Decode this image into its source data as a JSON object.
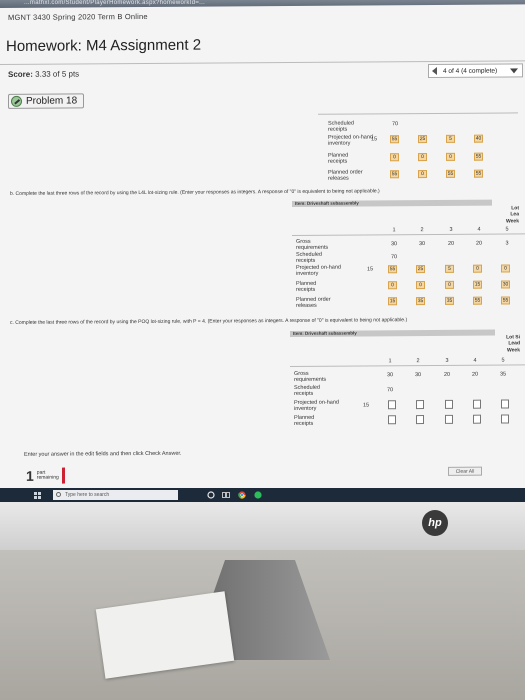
{
  "browser": {
    "url_fragment": "...mathxl.com/Student/PlayerHomework.aspx?homeworkId=..."
  },
  "header": {
    "course": "MGNT 3430 Spring 2020 Term B Online",
    "title": "Homework: M4 Assignment 2"
  },
  "score": {
    "label": "Score:",
    "value": "3.33 of 5 pts"
  },
  "question_nav": {
    "label": "4 of 4 (4 complete)"
  },
  "problem": {
    "label": "Problem 18"
  },
  "part_a": {
    "labels": [
      "Scheduled",
      "receipts",
      "Projected on-hand",
      "inventory",
      "Planned",
      "receipts",
      "Planned order",
      "releases"
    ],
    "scheduled": "70",
    "onhand_start": "15",
    "projected": [
      "55",
      "25",
      "5",
      "40"
    ],
    "planned_receipts": [
      "0",
      "0",
      "0",
      "55"
    ],
    "planned_releases": [
      "55",
      "0",
      "55",
      "55"
    ]
  },
  "part_b": {
    "instruction": "b. Complete the last three rows of the record by using the L4L lot-sizing rule. (Enter your responses as integers. A response of \"0\" is equivalent to being not applicable.)",
    "item": "Item: Driveshaft subassembly",
    "side": [
      "Lot",
      "Lea",
      "Week"
    ],
    "weeks": [
      "1",
      "2",
      "3",
      "4",
      "5"
    ],
    "gross": [
      "30",
      "30",
      "20",
      "20",
      "3"
    ],
    "scheduled": "70",
    "onhand_start": "15",
    "projected": [
      "55",
      "25",
      "5",
      "0",
      "0"
    ],
    "planned_receipts": [
      "0",
      "0",
      "0",
      "15",
      "30"
    ],
    "planned_releases": [
      "15",
      "35",
      "35",
      "55",
      "55"
    ],
    "labels": [
      "Gross",
      "requirements",
      "Scheduled",
      "receipts",
      "Projected on-hand",
      "inventory",
      "Planned",
      "receipts",
      "Planned order",
      "releases"
    ]
  },
  "part_c": {
    "instruction": "c. Complete the last three rows of the record by using the POQ lot-sizing rule, with P = 4. (Enter your responses as integers. A response of \"0\" is equivalent to being not applicable.)",
    "item": "Item: Driveshaft subassembly",
    "side": [
      "Lot Si",
      "Lead",
      "Week"
    ],
    "weeks": [
      "1",
      "2",
      "3",
      "4",
      "5"
    ],
    "gross": [
      "30",
      "30",
      "20",
      "20",
      "35"
    ],
    "scheduled": "70",
    "onhand_start": "15",
    "labels": [
      "Gross",
      "requirements",
      "Scheduled",
      "receipts",
      "Projected on-hand",
      "inventory",
      "Planned",
      "receipts"
    ]
  },
  "footer": {
    "note": "Enter your answer in the edit fields and then click Check Answer.",
    "parts_number": "1",
    "parts_text": [
      "part",
      "remaining"
    ],
    "clear_all": "Clear All"
  },
  "taskbar": {
    "search_placeholder": "Type here to search"
  },
  "brand": {
    "logo": "hp"
  }
}
